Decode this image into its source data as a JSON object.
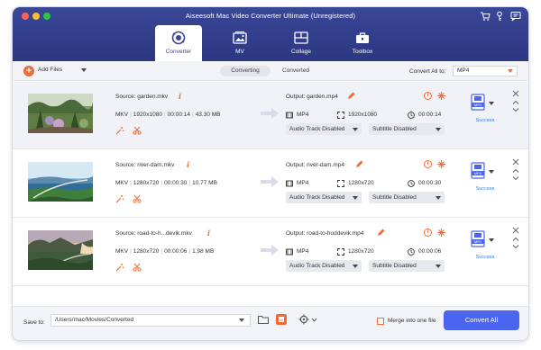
{
  "window": {
    "title": "Aiseesoft Mac Video Converter Ultimate (Unregistered)"
  },
  "tabs": [
    {
      "label": "Converter",
      "icon": "converter-icon",
      "active": true
    },
    {
      "label": "MV",
      "icon": "mv-icon",
      "active": false
    },
    {
      "label": "Collage",
      "icon": "collage-icon",
      "active": false
    },
    {
      "label": "Toolbox",
      "icon": "toolbox-icon",
      "active": false
    }
  ],
  "toolbar": {
    "add_files_label": "Add Files",
    "segments": [
      {
        "label": "Converting",
        "active": true
      },
      {
        "label": "Converted",
        "active": false
      }
    ],
    "convert_all_label": "Convert All to:",
    "convert_all_value": "MP4"
  },
  "files": [
    {
      "source": "Source: garden.mkv",
      "format": "MKV",
      "resolution": "1920x1080",
      "duration": "00:00:14",
      "size": "43.30 MB",
      "output": "Output: garden.mp4",
      "out_format": "MP4",
      "out_resolution": "1920x1080",
      "out_duration": "00:00:14",
      "audio": "Audio Track Disabled",
      "subtitle": "Subtitle Disabled",
      "status": "Success",
      "badge": "MP4"
    },
    {
      "source": "Source: river-dam.mkv",
      "format": "MKV",
      "resolution": "1280x720",
      "duration": "00:00:30",
      "size": "10.77 MB",
      "output": "Output: river-dam.mp4",
      "out_format": "MP4",
      "out_resolution": "1280x720",
      "out_duration": "00:00:30",
      "audio": "Audio Track Disabled",
      "subtitle": "Subtitle Disabled",
      "status": "Success",
      "badge": "MP4"
    },
    {
      "source": "Source: road-to-h...devik.mkv",
      "format": "MKV",
      "resolution": "1280x720",
      "duration": "00:00:06",
      "size": "1.98 MB",
      "output": "Output: road-to-hoddevik.mp4",
      "out_format": "MP4",
      "out_resolution": "1280x720",
      "out_duration": "00:00:06",
      "audio": "Audio Track Disabled",
      "subtitle": "Subtitle Disabled",
      "status": "Success",
      "badge": "MP4"
    }
  ],
  "bottom": {
    "save_to_label": "Save to:",
    "save_path": "/Users/mac/Movies/Converted",
    "merge_label": "Merge into one file",
    "convert_all_button": "Convert All"
  },
  "colors": {
    "header": "#3a4797",
    "accent": "#f26a35",
    "primary_button": "#4b65f0",
    "status": "#2f7de1"
  }
}
